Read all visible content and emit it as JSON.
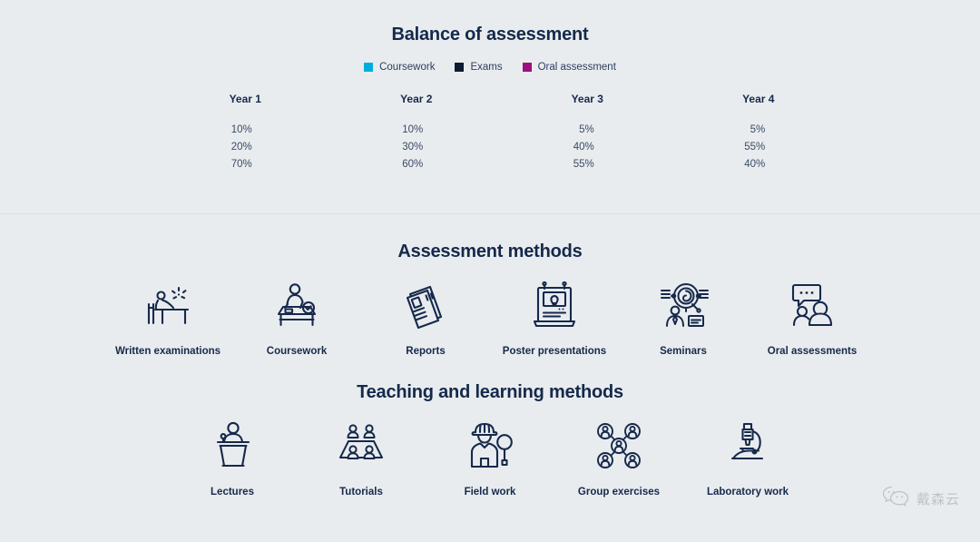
{
  "balance": {
    "title": "Balance of assessment",
    "legend": [
      {
        "label": "Coursework",
        "color": "#00aedb",
        "icon": "legend-swatch-coursework"
      },
      {
        "label": "Exams",
        "color": "#0d1b33",
        "icon": "legend-swatch-exams"
      },
      {
        "label": "Oral assessment",
        "color": "#9b0f7f",
        "icon": "legend-swatch-oral"
      }
    ],
    "columns": [
      {
        "header": "Year 1",
        "values": [
          "10%",
          "20%",
          "70%"
        ]
      },
      {
        "header": "Year 2",
        "values": [
          "10%",
          "30%",
          "60%"
        ]
      },
      {
        "header": "Year 3",
        "values": [
          "5%",
          "40%",
          "55%"
        ]
      },
      {
        "header": "Year 4",
        "values": [
          "5%",
          "55%",
          "40%"
        ]
      }
    ]
  },
  "assessment_methods": {
    "title": "Assessment methods",
    "items": [
      {
        "label": "Written examinations",
        "icon": "desk-writing-icon"
      },
      {
        "label": "Coursework",
        "icon": "desk-marking-icon"
      },
      {
        "label": "Reports",
        "icon": "documents-icon"
      },
      {
        "label": "Poster presentations",
        "icon": "poster-board-icon"
      },
      {
        "label": "Seminars",
        "icon": "presenter-network-icon"
      },
      {
        "label": "Oral assessments",
        "icon": "two-people-speech-icon"
      }
    ]
  },
  "teaching_methods": {
    "title": "Teaching and learning methods",
    "items": [
      {
        "label": "Lectures",
        "icon": "podium-speaker-icon"
      },
      {
        "label": "Tutorials",
        "icon": "table-group-icon"
      },
      {
        "label": "Field work",
        "icon": "hardhat-magnifier-icon"
      },
      {
        "label": "Group exercises",
        "icon": "people-network-icon"
      },
      {
        "label": "Laboratory work",
        "icon": "microscope-icon"
      }
    ]
  },
  "watermark": {
    "text": "戴森云",
    "icon": "wechat-icon"
  },
  "chart_data": {
    "type": "table",
    "title": "Balance of assessment",
    "categories": [
      "Year 1",
      "Year 2",
      "Year 3",
      "Year 4"
    ],
    "series": [
      {
        "name": "Coursework",
        "color": "#00aedb",
        "values": [
          10,
          10,
          5,
          5
        ]
      },
      {
        "name": "Exams",
        "color": "#0d1b33",
        "values": [
          20,
          30,
          40,
          55
        ]
      },
      {
        "name": "Oral assessment",
        "color": "#9b0f7f",
        "values": [
          70,
          60,
          55,
          40
        ]
      }
    ],
    "unit": "%",
    "xlabel": "",
    "ylabel": "",
    "legend_position": "top"
  }
}
